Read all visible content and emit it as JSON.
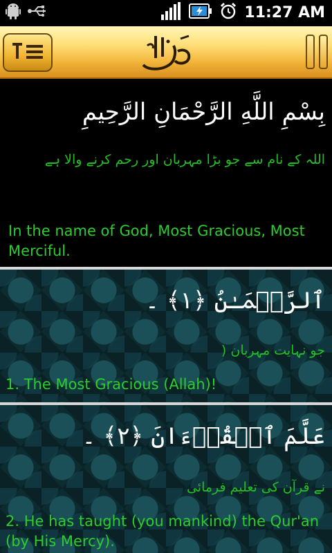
{
  "status_bar": {
    "time": "11:27 AM",
    "icons": [
      "android-icon",
      "usb-icon",
      "signal-icon",
      "battery-charging-icon",
      "alarm-icon"
    ]
  },
  "header": {
    "menu_icon": "list-menu-icon",
    "logo_icon": "ar-rahman-calligraphy-icon",
    "pause_icon": "pause-icon",
    "accent_color": "#f2b53a"
  },
  "verses": [
    {
      "arabic": "بِسْمِ اللَّهِ الرَّحْمَانِ الرَّحِيمِ",
      "urdu": "اللہ کے نام سے جو بڑا مہربان اور رحم کرنے والا ہے",
      "english": "In the name of God, Most Gracious, Most Merciful."
    },
    {
      "arabic": "ٱلرَّحۡمَـٰنُ ﴿١﴾ ۔",
      "urdu": "جو نہایت مہربان (",
      "english": "1. The Most Gracious (Allah)!"
    },
    {
      "arabic": "عَلَّمَ ٱلۡقُرۡءَانَ ﴿٢﴾ ۔",
      "urdu": "نے قرآن کی تعلیم فرمائی",
      "english": "2. He has taught (you mankind) the Qur'an (by His Mercy)."
    }
  ],
  "colors": {
    "translation_green": "#2ccd2c",
    "urdu_green": "#22c025",
    "pattern_bg": "#0d2c31"
  }
}
